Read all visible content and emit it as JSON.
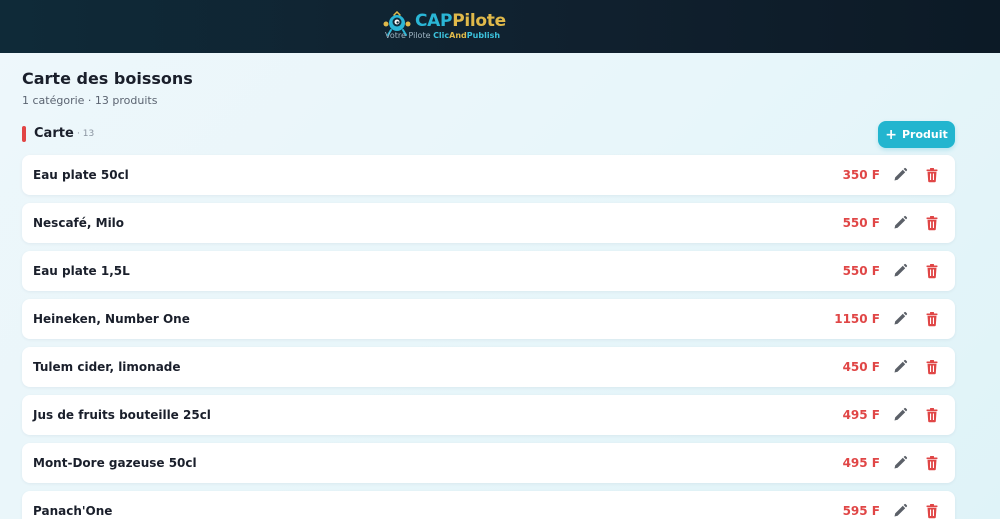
{
  "header": {
    "logo": {
      "title_part1": "CAP",
      "title_part2": "Pilote",
      "subtitle_part1": "Votre Pilote ",
      "subtitle_part2": "Clic",
      "subtitle_part3": "And",
      "subtitle_part4": "Publish"
    }
  },
  "page": {
    "title": "Carte des boissons",
    "subtitle": "1 catégorie · 13 produits"
  },
  "category": {
    "name": "Carte",
    "count": "· 13",
    "add_button_label": "Produit",
    "add_button_icon": "plus-icon"
  },
  "products": [
    {
      "name": "Eau plate 50cl",
      "price": "350 F"
    },
    {
      "name": "Nescafé, Milo",
      "price": "550 F"
    },
    {
      "name": "Eau plate 1,5L",
      "price": "550 F"
    },
    {
      "name": "Heineken, Number One",
      "price": "1150 F"
    },
    {
      "name": "Tulem cider, limonade",
      "price": "450 F"
    },
    {
      "name": "Jus de fruits bouteille 25cl",
      "price": "495 F"
    },
    {
      "name": "Mont-Dore gazeuse 50cl",
      "price": "495 F"
    },
    {
      "name": "Panach'One",
      "price": "595 F"
    }
  ],
  "icons": {
    "edit": "pencil-icon",
    "delete": "trash-icon"
  },
  "colors": {
    "accent": "#22b5cf",
    "price": "#e04646",
    "delete": "#e04646",
    "category_bar": "#e24545",
    "header_bg": "#0f2a38",
    "logo_gold": "#e0b94a"
  }
}
